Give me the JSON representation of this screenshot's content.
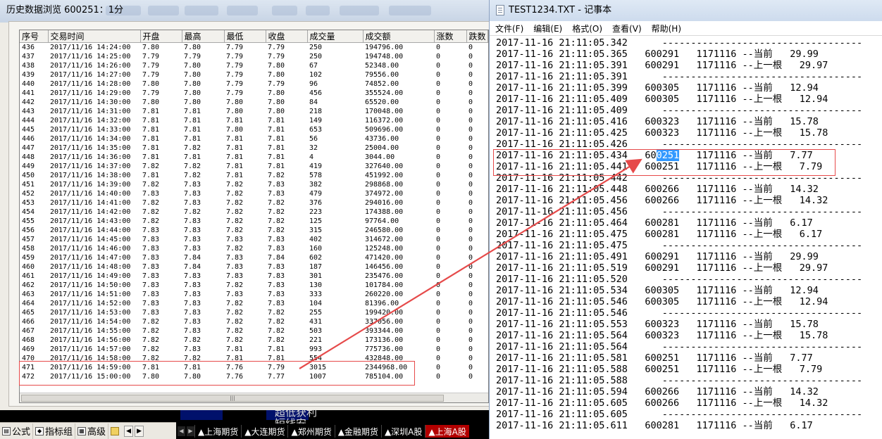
{
  "background": {
    "strip_texts": [
      "",
      "超低获利",
      "",
      "短线安"
    ],
    "red_mark": "..."
  },
  "history_window": {
    "title": "历史数据浏览 600251：1分",
    "columns": [
      "序号",
      "交易时间",
      "开盘",
      "最高",
      "最低",
      "收盘",
      "成交量",
      "成交额",
      "涨数",
      "跌数"
    ],
    "rows": [
      [
        "436",
        "2017/11/16 14:24:00",
        "7.80",
        "7.80",
        "7.79",
        "7.79",
        "250",
        "194796.00",
        "0",
        "0"
      ],
      [
        "437",
        "2017/11/16 14:25:00",
        "7.79",
        "7.79",
        "7.79",
        "7.79",
        "250",
        "194748.00",
        "0",
        "0"
      ],
      [
        "438",
        "2017/11/16 14:26:00",
        "7.79",
        "7.80",
        "7.79",
        "7.80",
        "67",
        "52348.00",
        "0",
        "0"
      ],
      [
        "439",
        "2017/11/16 14:27:00",
        "7.79",
        "7.80",
        "7.79",
        "7.80",
        "102",
        "79556.00",
        "0",
        "0"
      ],
      [
        "440",
        "2017/11/16 14:28:00",
        "7.80",
        "7.80",
        "7.79",
        "7.79",
        "96",
        "74852.00",
        "0",
        "0"
      ],
      [
        "441",
        "2017/11/16 14:29:00",
        "7.79",
        "7.80",
        "7.79",
        "7.80",
        "456",
        "355524.00",
        "0",
        "0"
      ],
      [
        "442",
        "2017/11/16 14:30:00",
        "7.80",
        "7.80",
        "7.80",
        "7.80",
        "84",
        "65520.00",
        "0",
        "0"
      ],
      [
        "443",
        "2017/11/16 14:31:00",
        "7.81",
        "7.81",
        "7.80",
        "7.80",
        "218",
        "170048.00",
        "0",
        "0"
      ],
      [
        "444",
        "2017/11/16 14:32:00",
        "7.81",
        "7.81",
        "7.81",
        "7.81",
        "149",
        "116372.00",
        "0",
        "0"
      ],
      [
        "445",
        "2017/11/16 14:33:00",
        "7.81",
        "7.81",
        "7.80",
        "7.81",
        "653",
        "509696.00",
        "0",
        "0"
      ],
      [
        "446",
        "2017/11/16 14:34:00",
        "7.81",
        "7.81",
        "7.81",
        "7.81",
        "56",
        "43736.00",
        "0",
        "0"
      ],
      [
        "447",
        "2017/11/16 14:35:00",
        "7.81",
        "7.82",
        "7.81",
        "7.81",
        "32",
        "25004.00",
        "0",
        "0"
      ],
      [
        "448",
        "2017/11/16 14:36:00",
        "7.81",
        "7.81",
        "7.81",
        "7.81",
        "4",
        "3044.00",
        "0",
        "0"
      ],
      [
        "449",
        "2017/11/16 14:37:00",
        "7.82",
        "7.82",
        "7.81",
        "7.81",
        "419",
        "327640.00",
        "0",
        "0"
      ],
      [
        "450",
        "2017/11/16 14:38:00",
        "7.81",
        "7.82",
        "7.81",
        "7.82",
        "578",
        "451992.00",
        "0",
        "0"
      ],
      [
        "451",
        "2017/11/16 14:39:00",
        "7.82",
        "7.83",
        "7.82",
        "7.83",
        "382",
        "298868.00",
        "0",
        "0"
      ],
      [
        "452",
        "2017/11/16 14:40:00",
        "7.83",
        "7.83",
        "7.82",
        "7.83",
        "479",
        "374972.00",
        "0",
        "0"
      ],
      [
        "453",
        "2017/11/16 14:41:00",
        "7.82",
        "7.83",
        "7.82",
        "7.82",
        "376",
        "294016.00",
        "0",
        "0"
      ],
      [
        "454",
        "2017/11/16 14:42:00",
        "7.82",
        "7.82",
        "7.82",
        "7.82",
        "223",
        "174388.00",
        "0",
        "0"
      ],
      [
        "455",
        "2017/11/16 14:43:00",
        "7.82",
        "7.83",
        "7.82",
        "7.82",
        "125",
        "97764.00",
        "0",
        "0"
      ],
      [
        "456",
        "2017/11/16 14:44:00",
        "7.83",
        "7.83",
        "7.82",
        "7.82",
        "315",
        "246580.00",
        "0",
        "0"
      ],
      [
        "457",
        "2017/11/16 14:45:00",
        "7.83",
        "7.83",
        "7.83",
        "7.83",
        "402",
        "314672.00",
        "0",
        "0"
      ],
      [
        "458",
        "2017/11/16 14:46:00",
        "7.83",
        "7.83",
        "7.82",
        "7.83",
        "160",
        "125248.00",
        "0",
        "0"
      ],
      [
        "459",
        "2017/11/16 14:47:00",
        "7.83",
        "7.84",
        "7.83",
        "7.84",
        "602",
        "471420.00",
        "0",
        "0"
      ],
      [
        "460",
        "2017/11/16 14:48:00",
        "7.83",
        "7.84",
        "7.83",
        "7.83",
        "187",
        "146456.00",
        "0",
        "0"
      ],
      [
        "461",
        "2017/11/16 14:49:00",
        "7.83",
        "7.83",
        "7.83",
        "7.83",
        "301",
        "235476.00",
        "0",
        "0"
      ],
      [
        "462",
        "2017/11/16 14:50:00",
        "7.83",
        "7.83",
        "7.82",
        "7.83",
        "130",
        "101784.00",
        "0",
        "0"
      ],
      [
        "463",
        "2017/11/16 14:51:00",
        "7.83",
        "7.83",
        "7.83",
        "7.83",
        "333",
        "260220.00",
        "0",
        "0"
      ],
      [
        "464",
        "2017/11/16 14:52:00",
        "7.83",
        "7.83",
        "7.82",
        "7.83",
        "104",
        "81396.00",
        "0",
        "0"
      ],
      [
        "465",
        "2017/11/16 14:53:00",
        "7.83",
        "7.83",
        "7.82",
        "7.82",
        "255",
        "199420.00",
        "0",
        "0"
      ],
      [
        "466",
        "2017/11/16 14:54:00",
        "7.82",
        "7.83",
        "7.82",
        "7.82",
        "431",
        "337056.00",
        "0",
        "0"
      ],
      [
        "467",
        "2017/11/16 14:55:00",
        "7.82",
        "7.83",
        "7.82",
        "7.82",
        "503",
        "393344.00",
        "0",
        "0"
      ],
      [
        "468",
        "2017/11/16 14:56:00",
        "7.82",
        "7.82",
        "7.82",
        "7.82",
        "221",
        "173136.00",
        "0",
        "0"
      ],
      [
        "469",
        "2017/11/16 14:57:00",
        "7.82",
        "7.83",
        "7.81",
        "7.81",
        "993",
        "775736.00",
        "0",
        "0"
      ],
      [
        "470",
        "2017/11/16 14:58:00",
        "7.82",
        "7.82",
        "7.81",
        "7.81",
        "554",
        "432848.00",
        "0",
        "0"
      ],
      [
        "471",
        "2017/11/16 14:59:00",
        "7.81",
        "7.81",
        "7.76",
        "7.79",
        "3015",
        "2344968.00",
        "0",
        "0"
      ],
      [
        "472",
        "2017/11/16 15:00:00",
        "7.80",
        "7.80",
        "7.76",
        "7.77",
        "1007",
        "785104.00",
        "0",
        "0"
      ]
    ],
    "scroll_grip": "|||"
  },
  "notepad": {
    "title": "TEST1234.TXT - 记事本",
    "menu": [
      "文件(F)",
      "编辑(E)",
      "格式(O)",
      "查看(V)",
      "帮助(H)"
    ],
    "lines": [
      {
        "t": "2017-11-16 21:11:05.342",
        "c": "",
        "v": "",
        "m": "",
        "p": "",
        "sep": "-----------------------------------"
      },
      {
        "t": "2017-11-16 21:11:05.365",
        "c": "600291",
        "v": "1171116",
        "m": "--当前",
        "p": "29.99",
        "sep": ""
      },
      {
        "t": "2017-11-16 21:11:05.391",
        "c": "600291",
        "v": "1171116",
        "m": "--上一根",
        "p": "29.97",
        "sep": ""
      },
      {
        "t": "2017-11-16 21:11:05.391",
        "c": "",
        "v": "",
        "m": "",
        "p": "",
        "sep": "-----------------------------------"
      },
      {
        "t": "2017-11-16 21:11:05.399",
        "c": "600305",
        "v": "1171116",
        "m": "--当前",
        "p": "12.94",
        "sep": ""
      },
      {
        "t": "2017-11-16 21:11:05.409",
        "c": "600305",
        "v": "1171116",
        "m": "--上一根",
        "p": "12.94",
        "sep": ""
      },
      {
        "t": "2017-11-16 21:11:05.409",
        "c": "",
        "v": "",
        "m": "",
        "p": "",
        "sep": "-----------------------------------"
      },
      {
        "t": "2017-11-16 21:11:05.416",
        "c": "600323",
        "v": "1171116",
        "m": "--当前",
        "p": "15.78",
        "sep": ""
      },
      {
        "t": "2017-11-16 21:11:05.425",
        "c": "600323",
        "v": "1171116",
        "m": "--上一根",
        "p": "15.78",
        "sep": ""
      },
      {
        "t": "2017-11-16 21:11:05.426",
        "c": "",
        "v": "",
        "m": "",
        "p": "",
        "sep": "-----------------------------------"
      },
      {
        "t": "2017-11-16 21:11:05.434",
        "c": "600251",
        "v": "1171116",
        "m": "--当前",
        "p": "7.77",
        "sep": "",
        "selected": "0251"
      },
      {
        "t": "2017-11-16 21:11:05.441",
        "c": "600251",
        "v": "1171116",
        "m": "--上一根",
        "p": "7.79",
        "sep": ""
      },
      {
        "t": "2017-11-16 21:11:05.442",
        "c": "",
        "v": "",
        "m": "",
        "p": "",
        "sep": "-----------------------------------"
      },
      {
        "t": "2017-11-16 21:11:05.448",
        "c": "600266",
        "v": "1171116",
        "m": "--当前",
        "p": "14.32",
        "sep": ""
      },
      {
        "t": "2017-11-16 21:11:05.456",
        "c": "600266",
        "v": "1171116",
        "m": "--上一根",
        "p": "14.32",
        "sep": ""
      },
      {
        "t": "2017-11-16 21:11:05.456",
        "c": "",
        "v": "",
        "m": "",
        "p": "",
        "sep": "-----------------------------------"
      },
      {
        "t": "2017-11-16 21:11:05.464",
        "c": "600281",
        "v": "1171116",
        "m": "--当前",
        "p": "6.17",
        "sep": ""
      },
      {
        "t": "2017-11-16 21:11:05.475",
        "c": "600281",
        "v": "1171116",
        "m": "--上一根",
        "p": "6.17",
        "sep": ""
      },
      {
        "t": "2017-11-16 21:11:05.475",
        "c": "",
        "v": "",
        "m": "",
        "p": "",
        "sep": "-----------------------------------"
      },
      {
        "t": "2017-11-16 21:11:05.491",
        "c": "600291",
        "v": "1171116",
        "m": "--当前",
        "p": "29.99",
        "sep": ""
      },
      {
        "t": "2017-11-16 21:11:05.519",
        "c": "600291",
        "v": "1171116",
        "m": "--上一根",
        "p": "29.97",
        "sep": ""
      },
      {
        "t": "2017-11-16 21:11:05.520",
        "c": "",
        "v": "",
        "m": "",
        "p": "",
        "sep": "-----------------------------------"
      },
      {
        "t": "2017-11-16 21:11:05.534",
        "c": "600305",
        "v": "1171116",
        "m": "--当前",
        "p": "12.94",
        "sep": ""
      },
      {
        "t": "2017-11-16 21:11:05.546",
        "c": "600305",
        "v": "1171116",
        "m": "--上一根",
        "p": "12.94",
        "sep": ""
      },
      {
        "t": "2017-11-16 21:11:05.546",
        "c": "",
        "v": "",
        "m": "",
        "p": "",
        "sep": "-----------------------------------"
      },
      {
        "t": "2017-11-16 21:11:05.553",
        "c": "600323",
        "v": "1171116",
        "m": "--当前",
        "p": "15.78",
        "sep": ""
      },
      {
        "t": "2017-11-16 21:11:05.564",
        "c": "600323",
        "v": "1171116",
        "m": "--上一根",
        "p": "15.78",
        "sep": ""
      },
      {
        "t": "2017-11-16 21:11:05.564",
        "c": "",
        "v": "",
        "m": "",
        "p": "",
        "sep": "-----------------------------------"
      },
      {
        "t": "2017-11-16 21:11:05.581",
        "c": "600251",
        "v": "1171116",
        "m": "--当前",
        "p": "7.77",
        "sep": ""
      },
      {
        "t": "2017-11-16 21:11:05.588",
        "c": "600251",
        "v": "1171116",
        "m": "--上一根",
        "p": "7.79",
        "sep": ""
      },
      {
        "t": "2017-11-16 21:11:05.588",
        "c": "",
        "v": "",
        "m": "",
        "p": "",
        "sep": "-----------------------------------"
      },
      {
        "t": "2017-11-16 21:11:05.594",
        "c": "600266",
        "v": "1171116",
        "m": "--当前",
        "p": "14.32",
        "sep": ""
      },
      {
        "t": "2017-11-16 21:11:05.605",
        "c": "600266",
        "v": "1171116",
        "m": "--上一根",
        "p": "14.32",
        "sep": ""
      },
      {
        "t": "2017-11-16 21:11:05.605",
        "c": "",
        "v": "",
        "m": "",
        "p": "",
        "sep": "-----------------------------------"
      },
      {
        "t": "2017-11-16 21:11:05.611",
        "c": "600281",
        "v": "1171116",
        "m": "--当前",
        "p": "6.17",
        "sep": ""
      }
    ]
  },
  "left_toolbar": {
    "formula": "公式",
    "indicator_group": "指标组",
    "advanced": "高级"
  },
  "exchange_tabs": [
    "▲上海期货",
    "▲大连期货",
    "▲郑州期货",
    "▲金融期货",
    "▲深圳A股",
    "▲上海A股"
  ],
  "colors": {
    "annotation_red": "#e64a4a",
    "selection_blue": "#3399ff",
    "active_tab": "#b30000"
  }
}
